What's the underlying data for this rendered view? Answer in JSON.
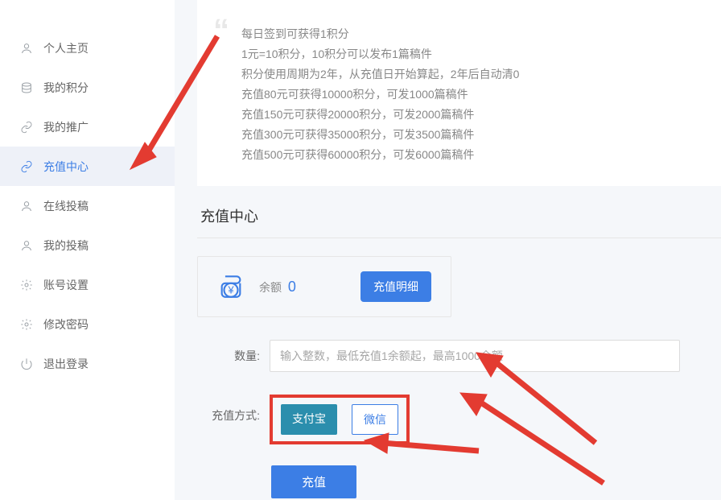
{
  "sidebar": {
    "items": [
      {
        "label": "个人主页",
        "icon": "user-icon"
      },
      {
        "label": "我的积分",
        "icon": "stack-icon"
      },
      {
        "label": "我的推广",
        "icon": "link-icon"
      },
      {
        "label": "充值中心",
        "icon": "link-icon"
      },
      {
        "label": "在线投稿",
        "icon": "user-icon"
      },
      {
        "label": "我的投稿",
        "icon": "user-icon"
      },
      {
        "label": "账号设置",
        "icon": "gear-icon"
      },
      {
        "label": "修改密码",
        "icon": "gear-icon"
      },
      {
        "label": "退出登录",
        "icon": "power-icon"
      }
    ],
    "active_index": 3
  },
  "info": {
    "lines": [
      "每日签到可获得1积分",
      "1元=10积分，10积分可以发布1篇稿件",
      "积分使用周期为2年，从充值日开始算起，2年后自动清0",
      "充值80元可获得10000积分，可发1000篇稿件",
      "充值150元可获得20000积分，可发2000篇稿件",
      "充值300元可获得35000积分，可发3500篇稿件",
      "充值500元可获得60000积分，可发6000篇稿件"
    ]
  },
  "section_title": "充值中心",
  "balance": {
    "label": "余额",
    "value": "0",
    "detail_btn": "充值明细"
  },
  "form": {
    "qty_label": "数量:",
    "qty_placeholder": "输入整数，最低充值1余额起，最高1000余额",
    "method_label": "充值方式:",
    "alipay": "支付宝",
    "wechat": "微信",
    "submit": "充值"
  }
}
